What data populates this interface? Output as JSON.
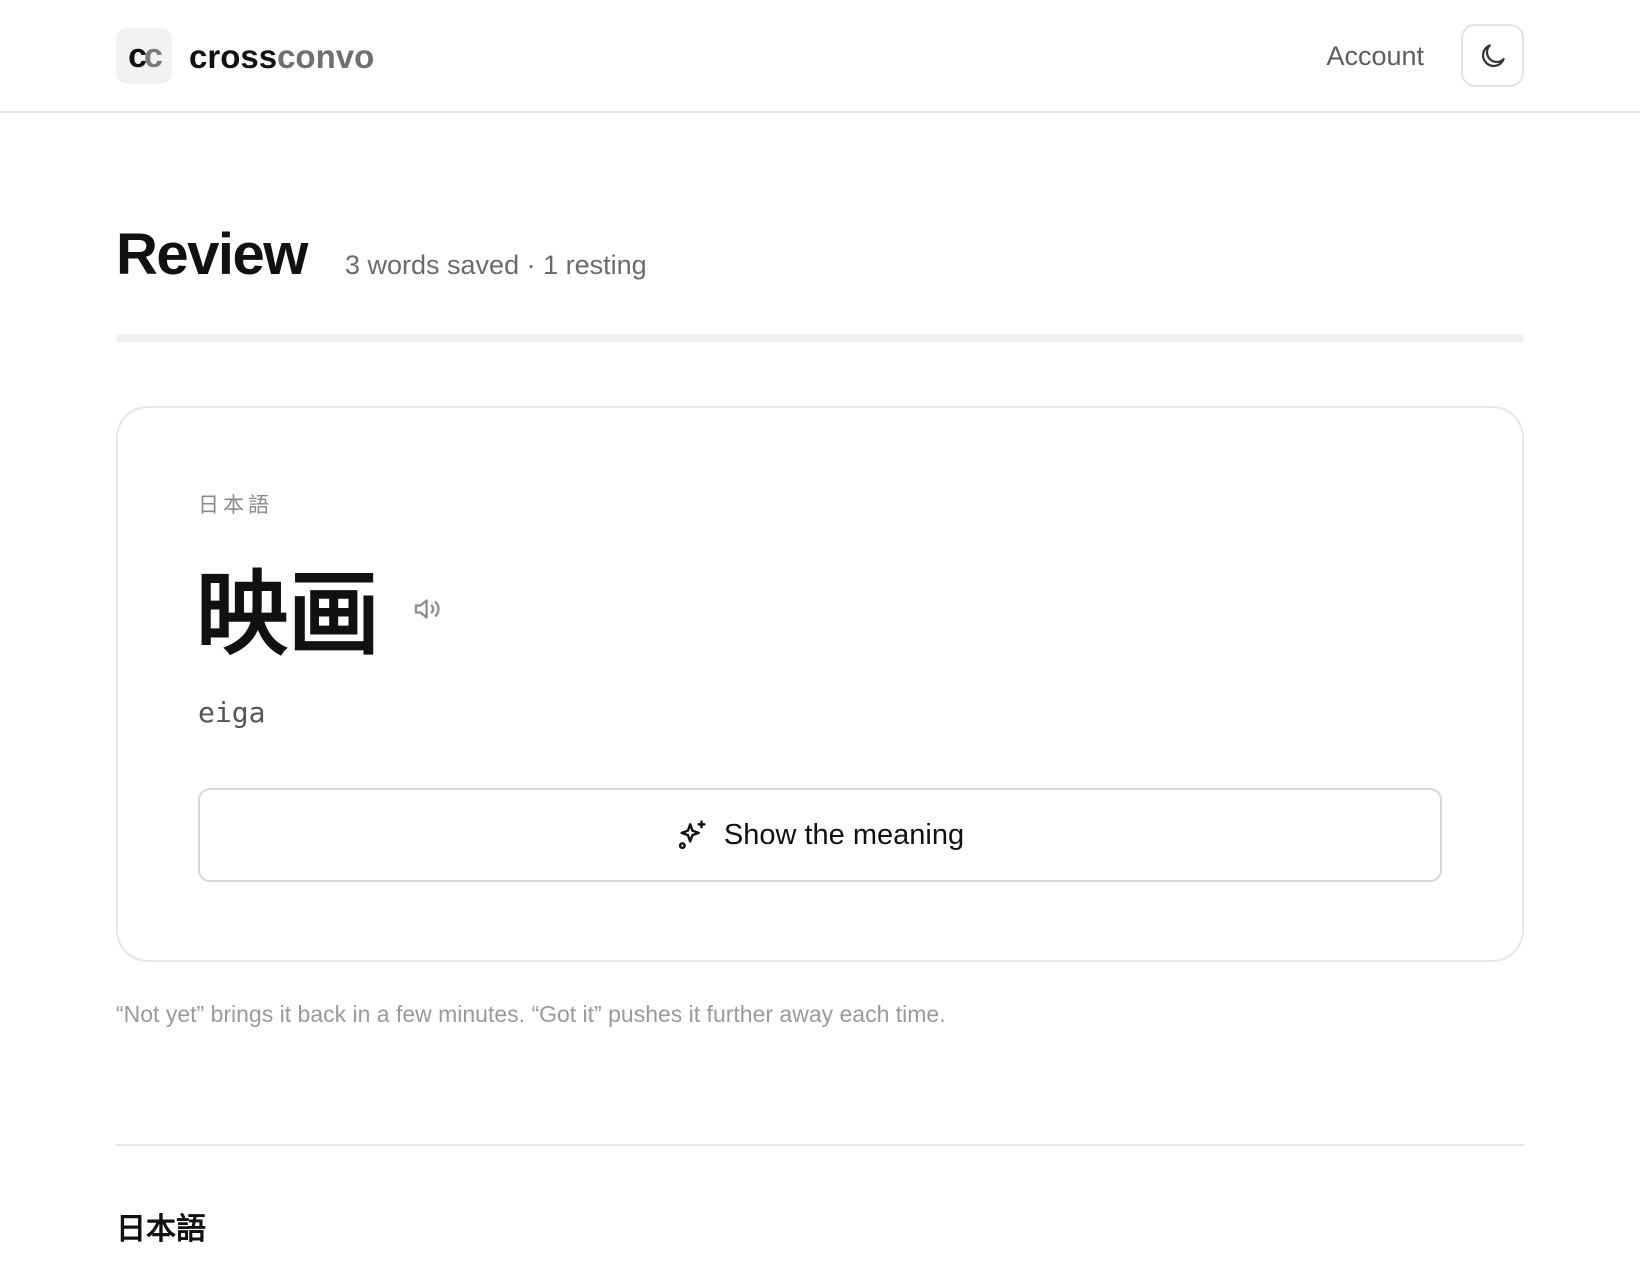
{
  "header": {
    "logo_mark": {
      "c1": "c",
      "c2": "c"
    },
    "brand": {
      "part1": "cross",
      "part2": "convo"
    },
    "account_label": "Account",
    "theme_toggle_icon": "moon-icon"
  },
  "review": {
    "title": "Review",
    "subtitle": "3 words saved · 1 resting",
    "progress": 0
  },
  "card": {
    "language": "日本語",
    "word": "映画",
    "romanization": "eiga",
    "speak_icon": "speaker-icon",
    "reveal_icon": "sparkle-icon",
    "reveal_label": "Show the meaning"
  },
  "hint": "“Not yet” brings it back in a few minutes. “Got it” pushes it further away each time.",
  "section": {
    "heading": "日本語"
  },
  "colors": {
    "text_primary": "#111111",
    "text_muted": "#6b6b6b",
    "border": "#e6e6e6",
    "background": "#ffffff"
  }
}
